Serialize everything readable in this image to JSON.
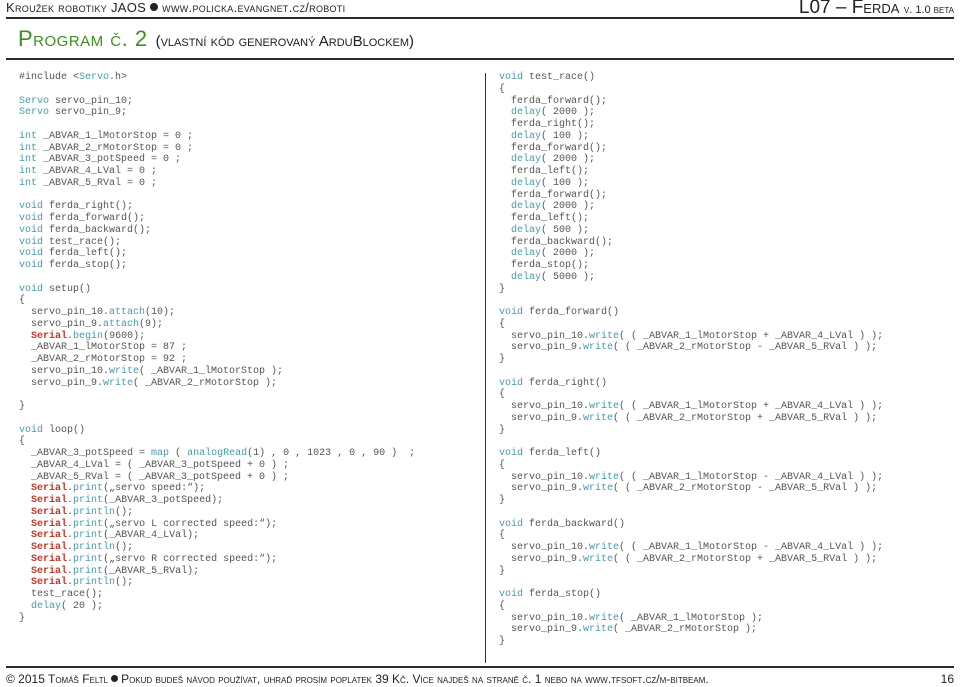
{
  "header": {
    "left_a": "Kroužek robotiky JAOS",
    "left_b": "www.policka.evangnet.cz/roboti",
    "lesson": "L07 – Ferda",
    "version": "v. 1.0 beta"
  },
  "title": {
    "main": "Program č. 2",
    "subtitle": "(vlastní kód generovaný ArduBlockem)"
  },
  "code_left": [
    "#include <Servo.h>",
    "",
    "Servo servo_pin_10;",
    "Servo servo_pin_9;",
    "",
    "int _ABVAR_1_lMotorStop = 0 ;",
    "int _ABVAR_2_rMotorStop = 0 ;",
    "int _ABVAR_3_potSpeed = 0 ;",
    "int _ABVAR_4_LVal = 0 ;",
    "int _ABVAR_5_RVal = 0 ;",
    "",
    "void ferda_right();",
    "void ferda_forward();",
    "void ferda_backward();",
    "void test_race();",
    "void ferda_left();",
    "void ferda_stop();",
    "",
    "void setup()",
    "{",
    "  servo_pin_10.attach(10);",
    "  servo_pin_9.attach(9);",
    "  Serial.begin(9600);",
    "  _ABVAR_1_lMotorStop = 87 ;",
    "  _ABVAR_2_rMotorStop = 92 ;",
    "  servo_pin_10.write( _ABVAR_1_lMotorStop );",
    "  servo_pin_9.write( _ABVAR_2_rMotorStop );",
    "",
    "}",
    "",
    "void loop()",
    "{",
    "  _ABVAR_3_potSpeed = map ( analogRead(1) , 0 , 1023 , 0 , 90 )  ;",
    "  _ABVAR_4_LVal = ( _ABVAR_3_potSpeed + 0 ) ;",
    "  _ABVAR_5_RVal = ( _ABVAR_3_potSpeed + 0 ) ;",
    "  Serial.print(„servo speed:“);",
    "  Serial.print(_ABVAR_3_potSpeed);",
    "  Serial.println();",
    "  Serial.print(„servo L corrected speed:“);",
    "  Serial.print(_ABVAR_4_LVal);",
    "  Serial.println();",
    "  Serial.print(„servo R corrected speed:“);",
    "  Serial.print(_ABVAR_5_RVal);",
    "  Serial.println();",
    "  test_race();",
    "  delay( 20 );",
    "}"
  ],
  "code_right": [
    "void test_race()",
    "{",
    "  ferda_forward();",
    "  delay( 2000 );",
    "  ferda_right();",
    "  delay( 100 );",
    "  ferda_forward();",
    "  delay( 2000 );",
    "  ferda_left();",
    "  delay( 100 );",
    "  ferda_forward();",
    "  delay( 2000 );",
    "  ferda_left();",
    "  delay( 500 );",
    "  ferda_backward();",
    "  delay( 2000 );",
    "  ferda_stop();",
    "  delay( 5000 );",
    "}",
    "",
    "void ferda_forward()",
    "{",
    "  servo_pin_10.write( ( _ABVAR_1_lMotorStop + _ABVAR_4_LVal ) );",
    "  servo_pin_9.write( ( _ABVAR_2_rMotorStop - _ABVAR_5_RVal ) );",
    "}",
    "",
    "void ferda_right()",
    "{",
    "  servo_pin_10.write( ( _ABVAR_1_lMotorStop + _ABVAR_4_LVal ) );",
    "  servo_pin_9.write( ( _ABVAR_2_rMotorStop + _ABVAR_5_RVal ) );",
    "}",
    "",
    "void ferda_left()",
    "{",
    "  servo_pin_10.write( ( _ABVAR_1_lMotorStop - _ABVAR_4_LVal ) );",
    "  servo_pin_9.write( ( _ABVAR_2_rMotorStop - _ABVAR_5_RVal ) );",
    "}",
    "",
    "void ferda_backward()",
    "{",
    "  servo_pin_10.write( ( _ABVAR_1_lMotorStop - _ABVAR_4_LVal ) );",
    "  servo_pin_9.write( ( _ABVAR_2_rMotorStop + _ABVAR_5_RVal ) );",
    "}",
    "",
    "void ferda_stop()",
    "{",
    "  servo_pin_10.write( _ABVAR_1_lMotorStop );",
    "  servo_pin_9.write( _ABVAR_2_rMotorStop );",
    "}"
  ],
  "footer": {
    "copyright": "© 2015 Tomáš Feltl",
    "note": "Pokud budeš návod používat, uhraď prosím poplatek 39 Kč. Více najdeš na straně č. 1 nebo na www.tfsoft.cz/m-bitbeam.",
    "page": "16"
  },
  "colors": {
    "title_green": "#3c8f1e",
    "keyword_teal": "#4a9aa8",
    "serial_red": "#c0392b",
    "function_orange": "#d35400"
  }
}
